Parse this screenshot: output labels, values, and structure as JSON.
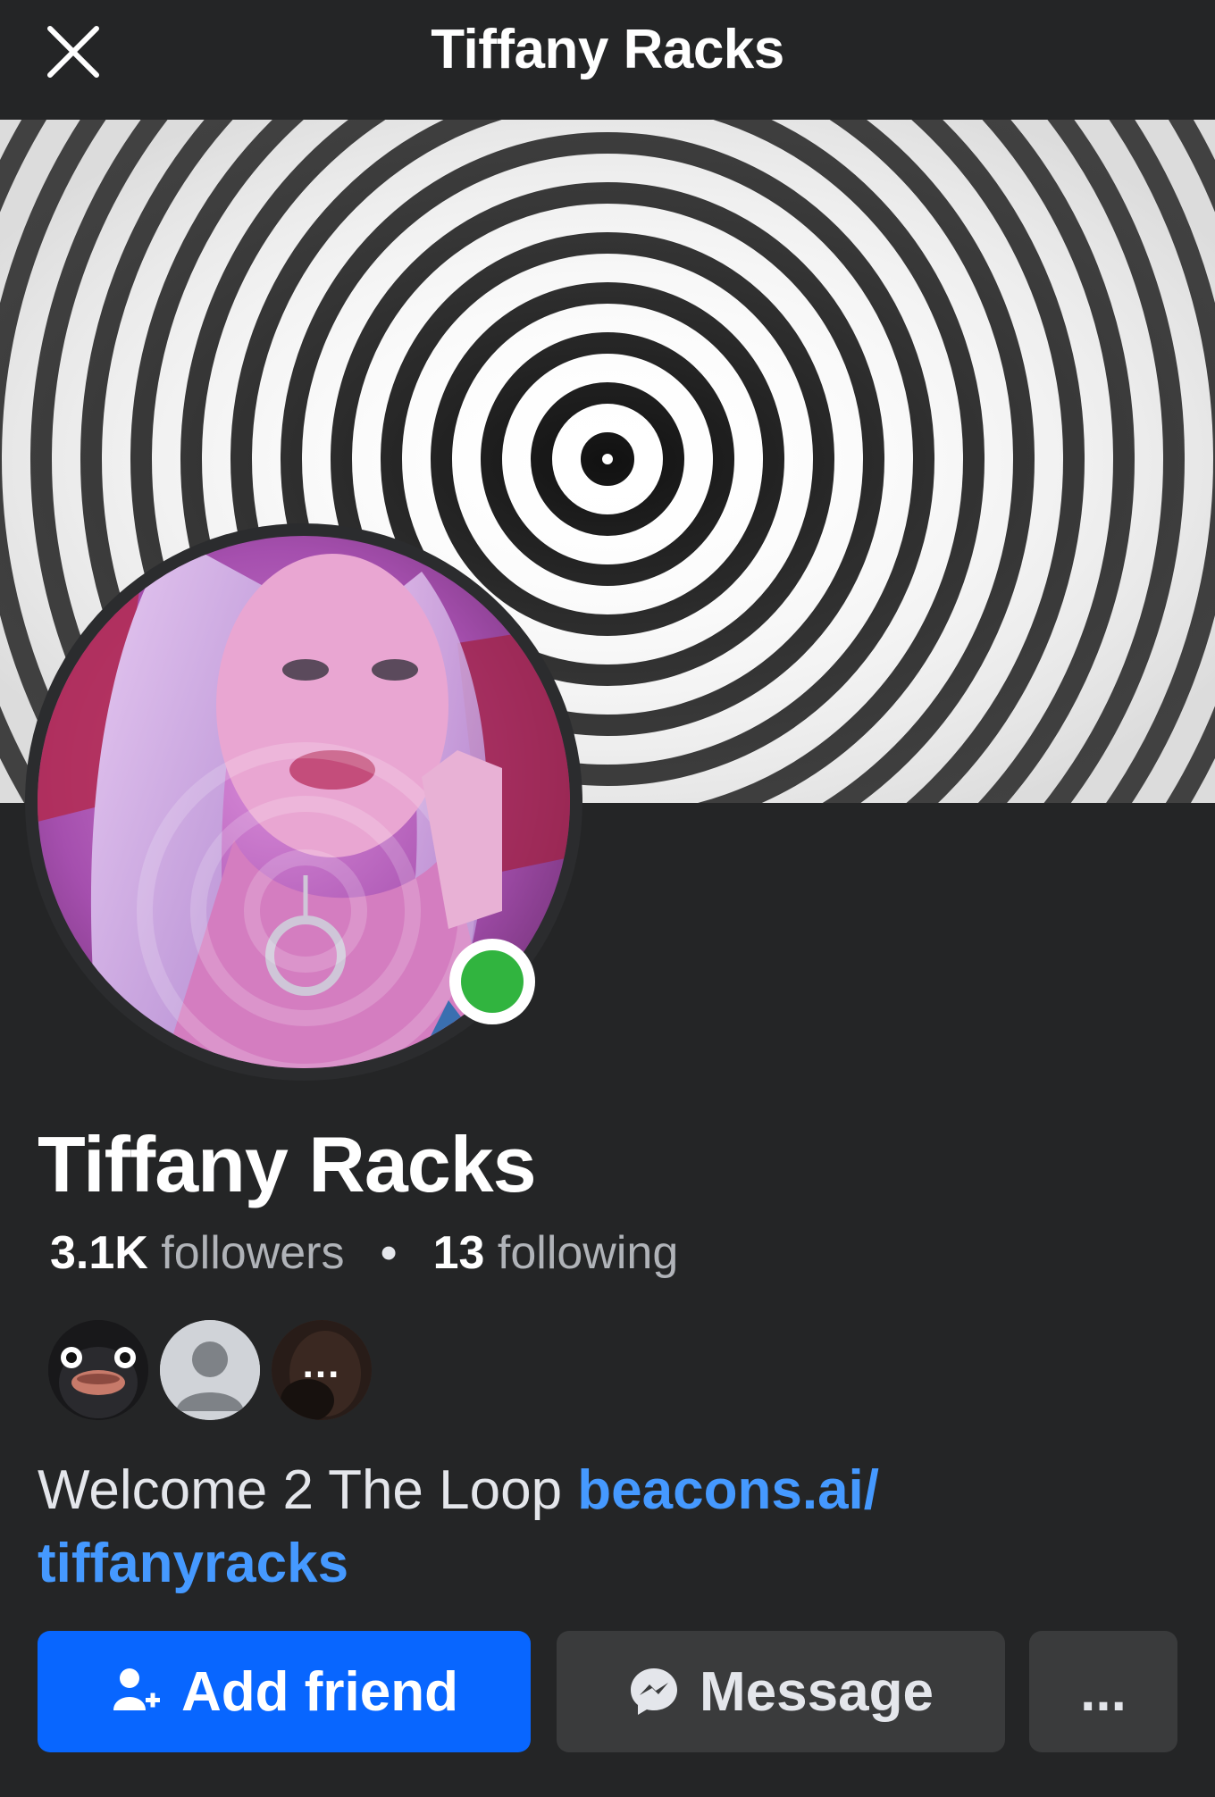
{
  "header": {
    "title": "Tiffany Racks",
    "close_icon": "close-icon"
  },
  "cover": {
    "description_icon": "hypnotic-spiral-cover"
  },
  "profile": {
    "name": "Tiffany Racks",
    "online": true,
    "online_color": "#31b43f",
    "followers_count": "3.1K",
    "followers_label": "followers",
    "separator": "•",
    "following_count": "13",
    "following_label": "following",
    "mutual_more": "...",
    "bio_text": "Welcome 2 The Loop ",
    "bio_link": "beacons.ai/ tiffanyracks",
    "link_color": "#4599ff"
  },
  "actions": {
    "add_friend_label": "Add friend",
    "message_label": "Message",
    "more_label": "...",
    "primary_color": "#0866ff",
    "secondary_color": "#3a3b3c"
  }
}
